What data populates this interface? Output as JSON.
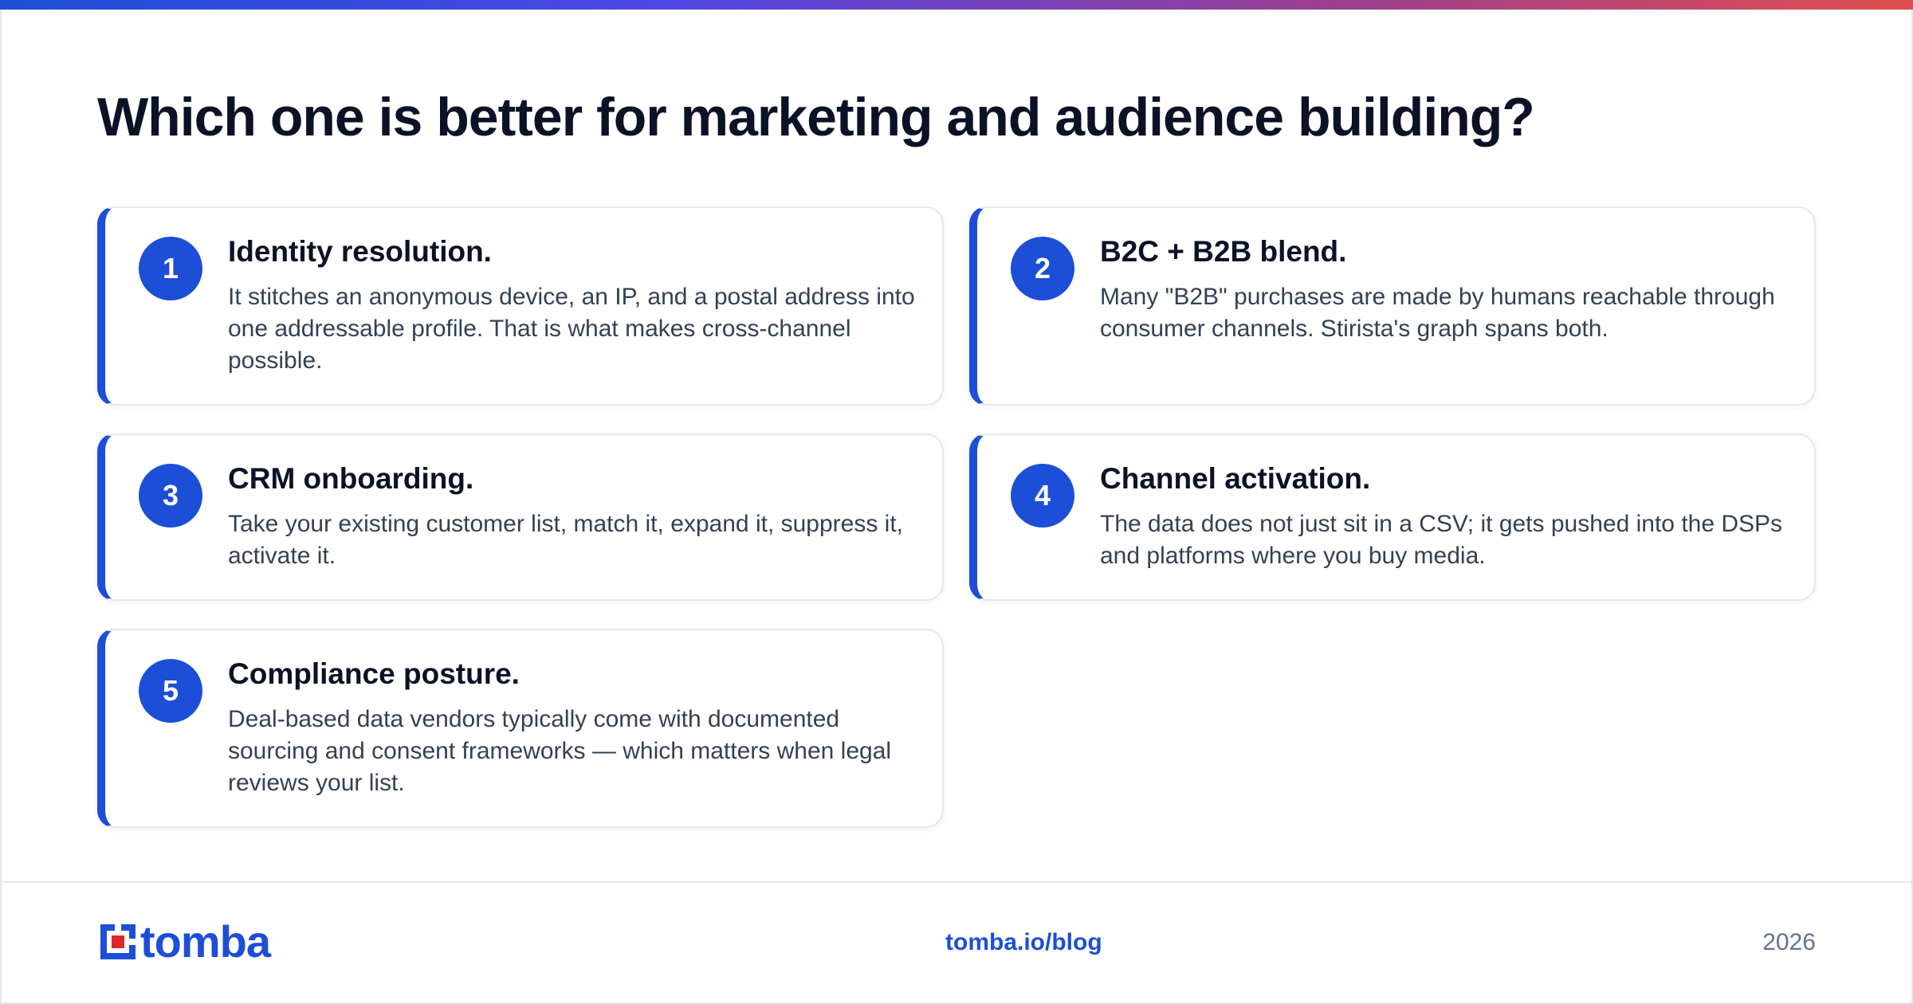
{
  "title": "Which one is better for marketing and audience building?",
  "colors": {
    "accent": "#1d4ed8",
    "heading": "#0b1226",
    "body_text": "#334155",
    "muted": "#64748b",
    "gradient_start": "#1d4ed8",
    "gradient_end": "#e04e4e",
    "logo_mark_red": "#e0262b"
  },
  "cards": [
    {
      "number": "1",
      "heading": "Identity resolution.",
      "body": "It stitches an anonymous device, an IP, and a postal address into one addressable profile. That is what makes cross-channel possible."
    },
    {
      "number": "2",
      "heading": "B2C + B2B blend.",
      "body": "Many \"B2B\" purchases are made by humans reachable through consumer channels. Stirista's graph spans both."
    },
    {
      "number": "3",
      "heading": "CRM onboarding.",
      "body": "Take your existing customer list, match it, expand it, suppress it, activate it."
    },
    {
      "number": "4",
      "heading": "Channel activation.",
      "body": "The data does not just sit in a CSV; it gets pushed into the DSPs and platforms where you buy media."
    },
    {
      "number": "5",
      "heading": "Compliance posture.",
      "body": "Deal-based data vendors typically come with documented sourcing and consent frameworks — which matters when legal reviews your list."
    }
  ],
  "footer": {
    "logo_icon": "tomba-logo-icon",
    "logo_text": "tomba",
    "link": "tomba.io/blog",
    "year": "2026"
  }
}
